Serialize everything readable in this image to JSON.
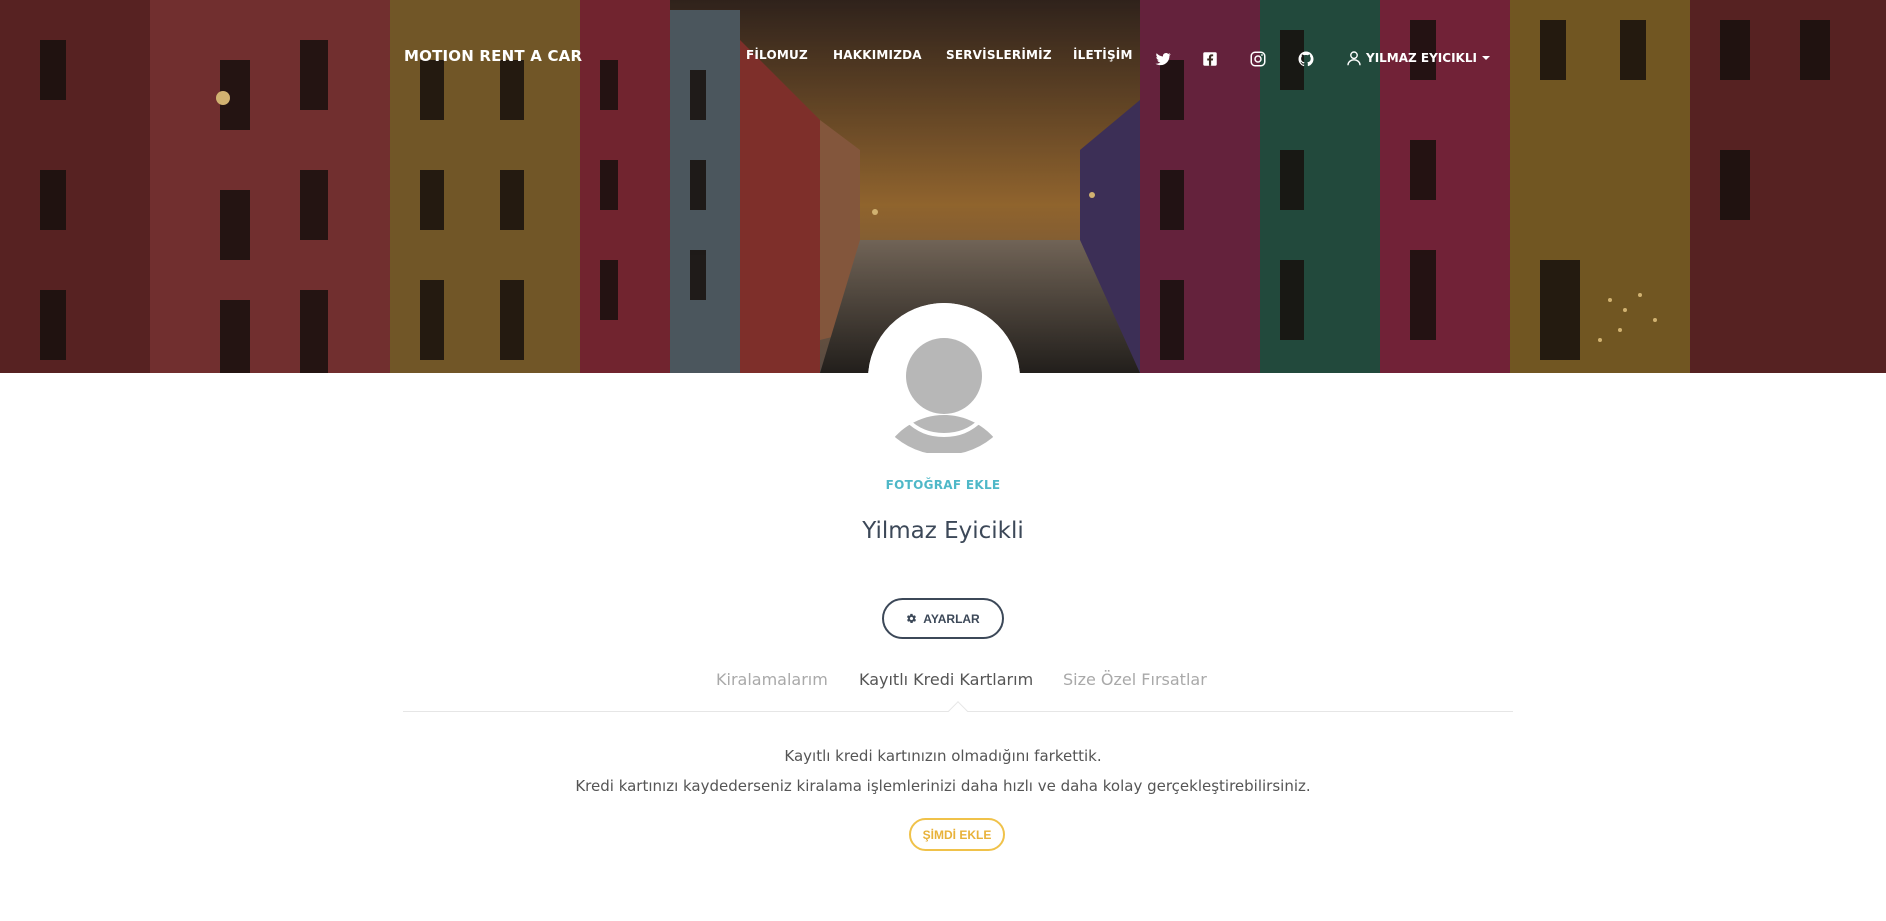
{
  "navbar": {
    "brand": "MOTION RENT A CAR",
    "links": [
      "FİLOMUZ",
      "HAKKIMIZDA",
      "SERVİSLERİMİZ",
      "İLETİŞİM"
    ],
    "social_icons": [
      "twitter-icon",
      "facebook-icon",
      "instagram-icon",
      "github-icon"
    ],
    "user": {
      "icon": "user-icon",
      "name": "YILMAZ EYICIKLI"
    }
  },
  "profile": {
    "add_photo": "FOTOĞRAF EKLE",
    "name": "Yilmaz Eyicikli",
    "settings_label": "AYARLAR",
    "settings_icon": "gear-icon"
  },
  "tabs": [
    {
      "label": "Kiralamalarım",
      "active": false
    },
    {
      "label": "Kayıtlı Kredi Kartlarım",
      "active": true
    },
    {
      "label": "Size Özel Fırsatlar",
      "active": false
    }
  ],
  "empty_state": {
    "line1": "Kayıtlı kredi kartınızın olmadığını farkettik.",
    "line2": "Kredi kartınızı kaydederseniz kiralama işlemlerinizi daha hızlı ve daha kolay gerçekleştirebilirsiniz.",
    "action": "ŞİMDİ EKLE"
  },
  "colors": {
    "accent": "#4fb8c8",
    "text": "#3c4858",
    "warning": "#f0c24a"
  }
}
